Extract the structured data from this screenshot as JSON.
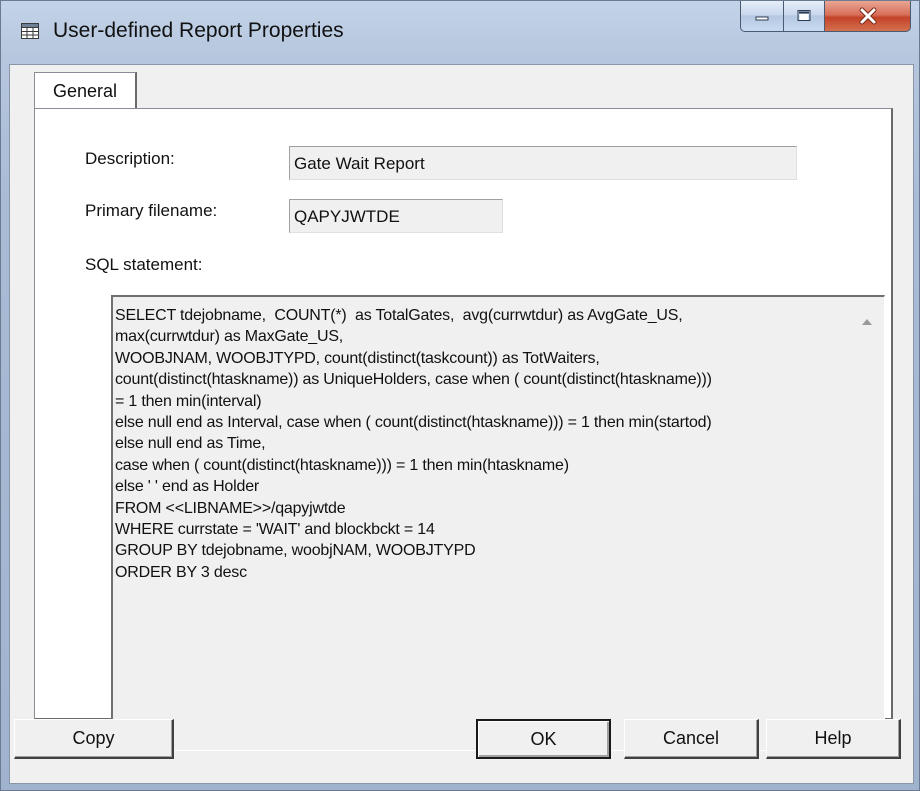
{
  "window": {
    "title": "User-defined Report Properties",
    "icon": "table-icon",
    "colors": {
      "frame": "#b5c6dd",
      "close_button": "#c4432a",
      "client": "#f0f0f0"
    }
  },
  "tabs": [
    {
      "label": "General",
      "selected": true
    }
  ],
  "form": {
    "description": {
      "label": "Description:",
      "value": "Gate Wait Report"
    },
    "primary_filename": {
      "label": "Primary filename:",
      "value": "QAPYJWTDE"
    },
    "sql_statement": {
      "label": "SQL statement:",
      "value": "SELECT tdejobname,  COUNT(*)  as TotalGates,  avg(currwtdur) as AvgGate_US,\nmax(currwtdur) as MaxGate_US,\nWOOBJNAM, WOOBJTYPD, count(distinct(taskcount)) as TotWaiters,\ncount(distinct(htaskname)) as UniqueHolders, case when ( count(distinct(htaskname)))\n= 1 then min(interval)\nelse null end as Interval, case when ( count(distinct(htaskname))) = 1 then min(startod)\nelse null end as Time,\ncase when ( count(distinct(htaskname))) = 1 then min(htaskname)\nelse ' ' end as Holder\nFROM <<LIBNAME>>/qapyjwtde\nWHERE currstate = 'WAIT' and blockbckt = 14\nGROUP BY tdejobname, woobjNAM, WOOBJTYPD\nORDER BY 3 desc"
    }
  },
  "buttons": {
    "copy": "Copy",
    "ok": "OK",
    "cancel": "Cancel",
    "help": "Help"
  }
}
